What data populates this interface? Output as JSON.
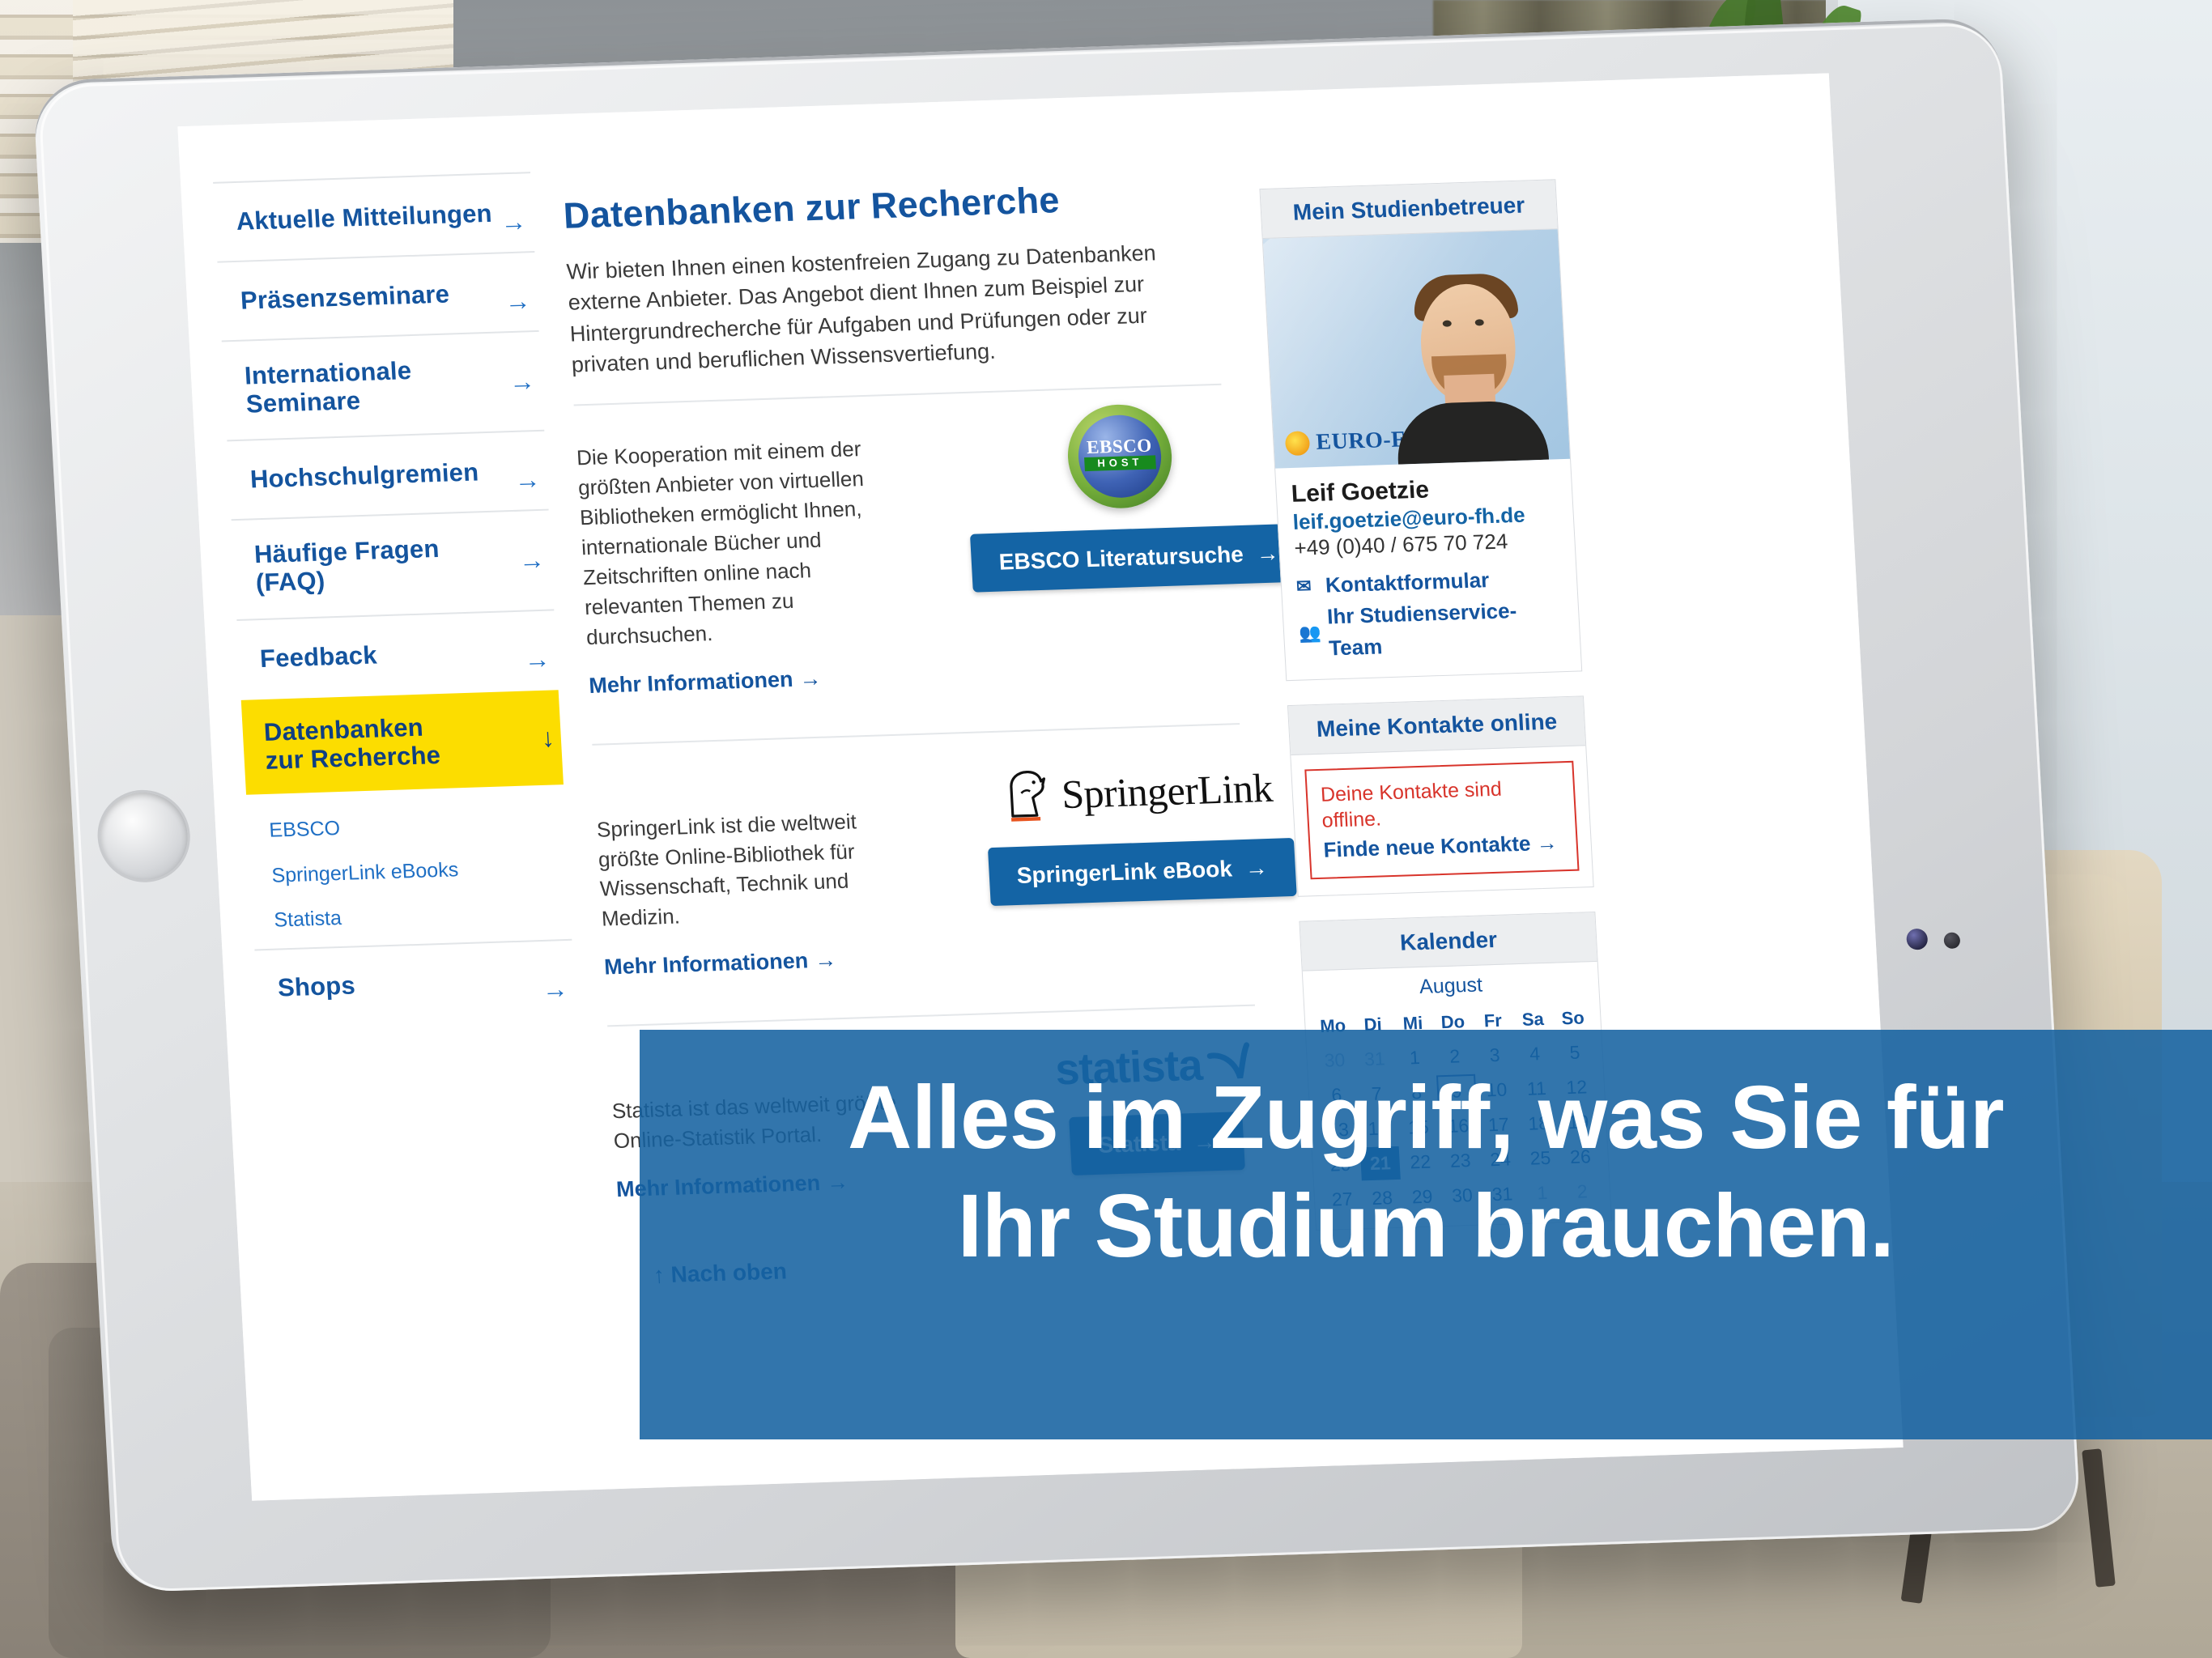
{
  "nav": {
    "items": [
      {
        "label": "Aktuelle Mitteilungen",
        "arrow": "→"
      },
      {
        "label": "Präsenzseminare",
        "arrow": "→"
      },
      {
        "label": "Internationale Seminare",
        "arrow": "→"
      },
      {
        "label": "Hochschulgremien",
        "arrow": "→"
      },
      {
        "label": "Häufige Fragen (FAQ)",
        "arrow": "→"
      },
      {
        "label": "Feedback",
        "arrow": "→"
      }
    ],
    "active": {
      "label": "Datenbanken zur Recherche",
      "arrow": "↓"
    },
    "sub_items": [
      {
        "label": "EBSCO"
      },
      {
        "label": "SpringerLink eBooks"
      },
      {
        "label": "Statista"
      }
    ],
    "shops": {
      "label": "Shops",
      "arrow": "→"
    }
  },
  "main": {
    "title": "Datenbanken zur Recherche",
    "intro": "Wir bieten Ihnen einen kostenfreien Zugang zu Datenbanken externe Anbieter. Das Angebot dient Ihnen zum Beispiel zur Hintergrundrecherche für Aufgaben und Prüfungen oder zur privaten und beruflichen Wissensvertiefung.",
    "more_label": "Mehr Informationen",
    "more_arrow": "→",
    "databases": [
      {
        "id": "ebsco",
        "text": "Die Kooperation mit einem der größten Anbieter von virtuellen Bibliotheken ermöglicht Ihnen, internationale Bücher und Zeitschriften online nach relevanten Themen zu durchsuchen.",
        "logo_name": "EBSCO",
        "logo_sub": "HOST",
        "button_label": "EBSCO Literatursuche",
        "button_arrow": "→"
      },
      {
        "id": "springerlink",
        "text": "SpringerLink ist die weltweit größte Online-Bibliothek für Wissenschaft, Technik und Medizin.",
        "logo_name": "SpringerLink",
        "button_label": "SpringerLink eBook",
        "button_arrow": "→"
      },
      {
        "id": "statista",
        "text": "Statista ist das weltweit größte Online-Statistik Portal.",
        "logo_name": "statista",
        "button_label": "Statista",
        "button_arrow": "→"
      }
    ],
    "back_to_top": "↑ Nach oben"
  },
  "aside": {
    "advisor_card": {
      "title": "Mein Studienbetreuer",
      "brand": "EURO-FH",
      "name": "Leif Goetzie",
      "email": "leif.goetzie@euro-fh.de",
      "phone": "+49 (0)40 / 675 70 724",
      "links": [
        {
          "icon": "✉",
          "label": "Kontaktformular"
        },
        {
          "icon": "👥",
          "label": "Ihr Studienservice-Team"
        }
      ]
    },
    "contacts_card": {
      "title": "Meine Kontakte online",
      "offline_text": "Deine Kontakte sind offline.",
      "find_label": "Finde neue Kontakte",
      "find_arrow": "→"
    },
    "calendar_card": {
      "title": "Kalender",
      "month": "August",
      "weekdays": [
        "Mo",
        "Di",
        "Mi",
        "Do",
        "Fr",
        "Sa",
        "So"
      ],
      "weeks": [
        [
          {
            "d": "30",
            "m": true
          },
          {
            "d": "31",
            "m": true
          },
          {
            "d": "1"
          },
          {
            "d": "2"
          },
          {
            "d": "3"
          },
          {
            "d": "4"
          },
          {
            "d": "5"
          }
        ],
        [
          {
            "d": "6"
          },
          {
            "d": "7"
          },
          {
            "d": "8"
          },
          {
            "d": "9",
            "r": true
          },
          {
            "d": "10"
          },
          {
            "d": "11"
          },
          {
            "d": "12"
          }
        ],
        [
          {
            "d": "13"
          },
          {
            "d": "14"
          },
          {
            "d": "15"
          },
          {
            "d": "16"
          },
          {
            "d": "17"
          },
          {
            "d": "18"
          },
          {
            "d": "19"
          }
        ],
        [
          {
            "d": "20"
          },
          {
            "d": "21",
            "t": true
          },
          {
            "d": "22"
          },
          {
            "d": "23"
          },
          {
            "d": "24"
          },
          {
            "d": "25"
          },
          {
            "d": "26"
          }
        ],
        [
          {
            "d": "27"
          },
          {
            "d": "28"
          },
          {
            "d": "29"
          },
          {
            "d": "30"
          },
          {
            "d": "31"
          },
          {
            "d": "1",
            "m": true
          },
          {
            "d": "2",
            "m": true
          }
        ]
      ]
    }
  },
  "overlay": {
    "line1": "Alles im Zugriff, was Sie für",
    "line2": "Ihr Studium brauchen."
  },
  "colors": {
    "brand_blue": "#14549e",
    "button_blue": "#1464a5",
    "highlight_yellow": "#fcdd00",
    "alert_red": "#d8342b",
    "overlay_blue": "#1662a0"
  }
}
